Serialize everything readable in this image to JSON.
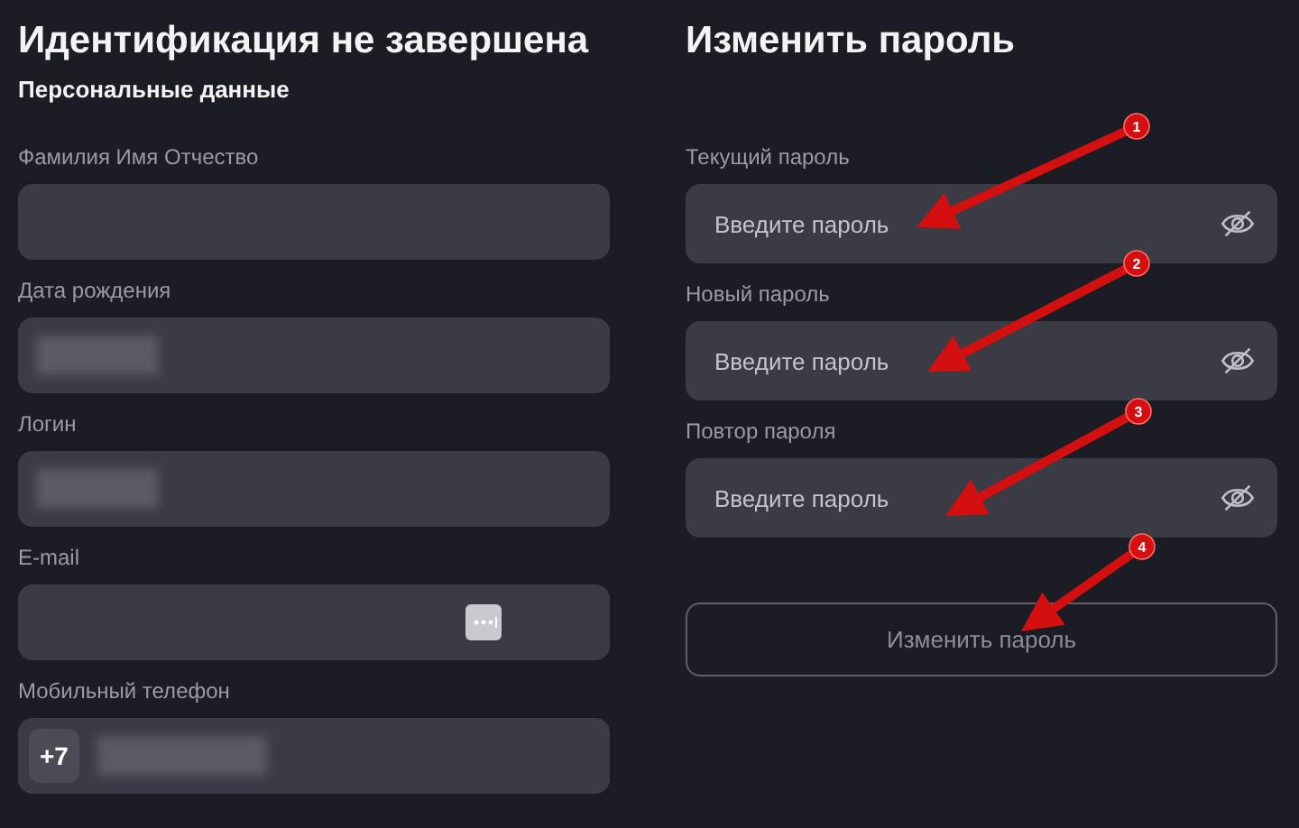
{
  "identification": {
    "title": "Идентификация не завершена",
    "subtitle": "Персональные данные",
    "fields": [
      {
        "label": "Фамилия Имя Отчество",
        "kind": "empty"
      },
      {
        "label": "Дата рождения",
        "kind": "blurred"
      },
      {
        "label": "Логин",
        "kind": "blurred"
      },
      {
        "label": "E-mail",
        "kind": "autofill"
      },
      {
        "label": "Мобильный телефон",
        "kind": "phone",
        "prefix": "+7"
      }
    ]
  },
  "password": {
    "title": "Изменить пароль",
    "fields": [
      {
        "label": "Текущий пароль",
        "placeholder": "Введите пароль",
        "annotation": "1"
      },
      {
        "label": "Новый пароль",
        "placeholder": "Введите пароль",
        "annotation": "2"
      },
      {
        "label": "Повтор пароля",
        "placeholder": "Введите пароль",
        "annotation": "3"
      }
    ],
    "button": {
      "label": "Изменить пароль",
      "disabled": true,
      "annotation": "4"
    }
  }
}
